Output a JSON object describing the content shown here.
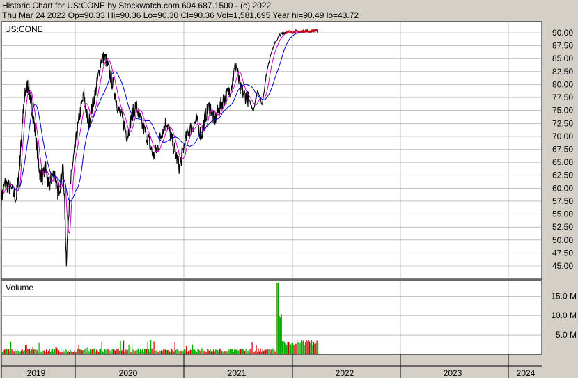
{
  "header": {
    "line1": "Historic Chart for US:CONE by Stockwatch.com 604.687.1500 - (c) 2022",
    "line2": "Thu Mar 24 2022   Op=90.33   Hi=90.36   Lo=90.30   Cl=90.36   Vol=1,581,695   Year hi=90.49   lo=43.72"
  },
  "chart_data": [
    {
      "type": "line",
      "title": "US:CONE",
      "x_labels": [
        "2019",
        "2020",
        "2021",
        "2022",
        "2023",
        "2024"
      ],
      "ylim": [
        43.72,
        91.5
      ],
      "y_ticks": [
        "90.00",
        "87.50",
        "85.00",
        "82.50",
        "80.00",
        "77.50",
        "75.00",
        "72.50",
        "70.00",
        "67.50",
        "65.00",
        "62.50",
        "60.00",
        "57.50",
        "55.00",
        "52.50",
        "50.00",
        "47.50",
        "45.00"
      ],
      "grid": true,
      "colors": {
        "price": "#000000",
        "ma_short": "#cc00cc",
        "ma_long": "#0000cc",
        "last": "#cc0000"
      },
      "series": [
        {
          "t": [
            0,
            0.05,
            0.12,
            0.2,
            0.25,
            0.28,
            0.32,
            0.36,
            0.4,
            0.44,
            0.48,
            0.52,
            0.56,
            0.6,
            0.64,
            0.68,
            0.72,
            0.76,
            0.8,
            0.84,
            0.88,
            0.92,
            0.96,
            1.0,
            1.04,
            1.08,
            1.12,
            1.16,
            1.2,
            1.24,
            1.28,
            1.32,
            1.36,
            1.4,
            1.44,
            1.48,
            1.52,
            1.56,
            1.6,
            1.64,
            1.68,
            1.72,
            1.76,
            1.8,
            1.84,
            1.88,
            1.92,
            1.96,
            2.0,
            2.04,
            2.08,
            2.12,
            2.16,
            2.2,
            2.24,
            2.28,
            2.32,
            2.36,
            2.4,
            2.44,
            2.48,
            2.52,
            2.56,
            2.6,
            2.64,
            2.68,
            2.72,
            2.76,
            2.8,
            2.84,
            2.88,
            2.92,
            2.96,
            3.0,
            3.04,
            3.08,
            3.12,
            3.16,
            3.2,
            3.24
          ],
          "values": [
            58,
            61,
            60,
            58,
            65,
            72,
            78,
            80,
            77,
            73,
            68,
            63,
            62,
            64,
            60,
            62,
            63,
            59,
            61,
            64,
            46,
            58,
            64,
            68,
            74,
            78,
            72,
            76,
            80,
            85,
            85,
            82,
            79,
            75,
            73,
            70,
            74,
            76,
            73,
            71,
            69,
            66,
            68,
            71,
            73,
            70,
            67,
            64,
            68,
            71,
            72,
            73,
            70,
            74,
            76,
            73,
            75,
            77,
            78,
            80,
            84,
            79,
            78,
            77,
            75,
            79,
            76,
            82,
            86,
            88,
            89.5,
            90,
            90.2,
            90.1,
            90.3,
            90.2,
            90.4,
            90.3,
            90.4,
            90.36
          ]
        }
      ],
      "last_value": 90.36
    },
    {
      "type": "bar",
      "title": "Volume",
      "ylim": [
        0,
        19
      ],
      "y_ticks": [
        "15.0 M",
        "10.0 M",
        "5.0 M"
      ],
      "grid": true,
      "colors": {
        "up": "#00aa00",
        "down": "#cc0000"
      },
      "spike_date": "2021.75",
      "spike_value": 18.5
    }
  ]
}
